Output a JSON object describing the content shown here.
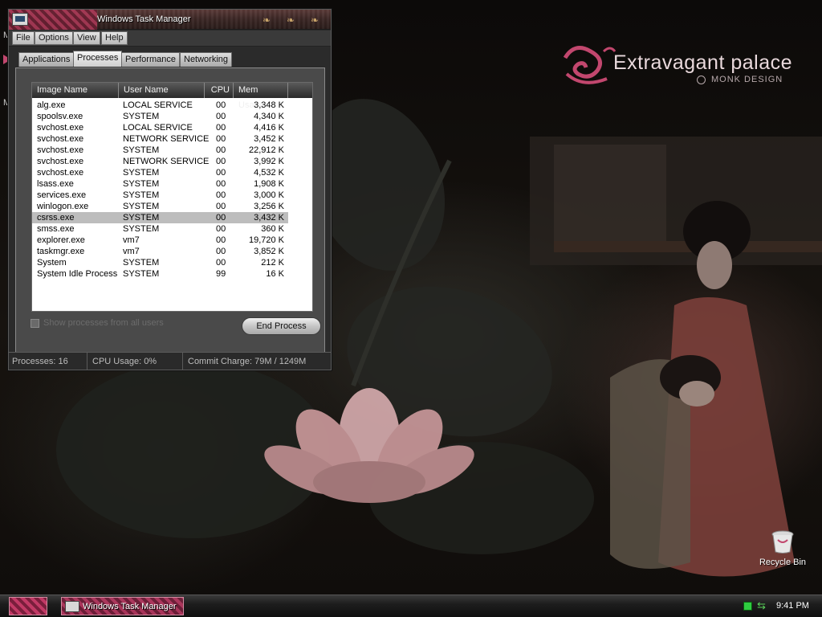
{
  "desktop": {
    "brand_title": "Extravagant palace",
    "brand_subtitle": "MONK DESIGN",
    "edge_letter": "M",
    "recycle_bin_label": "Recycle Bin"
  },
  "window": {
    "title": "Windows Task Manager",
    "menu": [
      "File",
      "Options",
      "View",
      "Help"
    ],
    "tabs": [
      "Applications",
      "Processes",
      "Performance",
      "Networking"
    ],
    "active_tab": "Processes",
    "columns": [
      "Image Name",
      "User Name",
      "CPU",
      "Mem Usage"
    ],
    "processes": [
      {
        "name": "alg.exe",
        "user": "LOCAL SERVICE",
        "cpu": "00",
        "mem": "3,348 K"
      },
      {
        "name": "spoolsv.exe",
        "user": "SYSTEM",
        "cpu": "00",
        "mem": "4,340 K"
      },
      {
        "name": "svchost.exe",
        "user": "LOCAL SERVICE",
        "cpu": "00",
        "mem": "4,416 K"
      },
      {
        "name": "svchost.exe",
        "user": "NETWORK SERVICE",
        "cpu": "00",
        "mem": "3,452 K"
      },
      {
        "name": "svchost.exe",
        "user": "SYSTEM",
        "cpu": "00",
        "mem": "22,912 K"
      },
      {
        "name": "svchost.exe",
        "user": "NETWORK SERVICE",
        "cpu": "00",
        "mem": "3,992 K"
      },
      {
        "name": "svchost.exe",
        "user": "SYSTEM",
        "cpu": "00",
        "mem": "4,532 K"
      },
      {
        "name": "lsass.exe",
        "user": "SYSTEM",
        "cpu": "00",
        "mem": "1,908 K"
      },
      {
        "name": "services.exe",
        "user": "SYSTEM",
        "cpu": "00",
        "mem": "3,000 K"
      },
      {
        "name": "winlogon.exe",
        "user": "SYSTEM",
        "cpu": "00",
        "mem": "3,256 K"
      },
      {
        "name": "csrss.exe",
        "user": "SYSTEM",
        "cpu": "00",
        "mem": "3,432 K",
        "selected": true
      },
      {
        "name": "smss.exe",
        "user": "SYSTEM",
        "cpu": "00",
        "mem": "360 K"
      },
      {
        "name": "explorer.exe",
        "user": "vm7",
        "cpu": "00",
        "mem": "19,720 K"
      },
      {
        "name": "taskmgr.exe",
        "user": "vm7",
        "cpu": "00",
        "mem": "3,852 K"
      },
      {
        "name": "System",
        "user": "SYSTEM",
        "cpu": "00",
        "mem": "212 K"
      },
      {
        "name": "System Idle Process",
        "user": "SYSTEM",
        "cpu": "99",
        "mem": "16 K"
      }
    ],
    "show_all_label": "Show processes from all users",
    "show_all_checked": false,
    "end_process_label": "End Process",
    "status": {
      "processes": "Processes: 16",
      "cpu": "CPU Usage: 0%",
      "commit": "Commit Charge: 79M / 1249M"
    }
  },
  "taskbar": {
    "task_label": "Windows Task Manager",
    "clock": "9:41 PM"
  },
  "colors": {
    "brand_pink": "#c2476e",
    "selected_row": "#bdbdbd",
    "titlebar_pattern": "#b03a5a"
  }
}
